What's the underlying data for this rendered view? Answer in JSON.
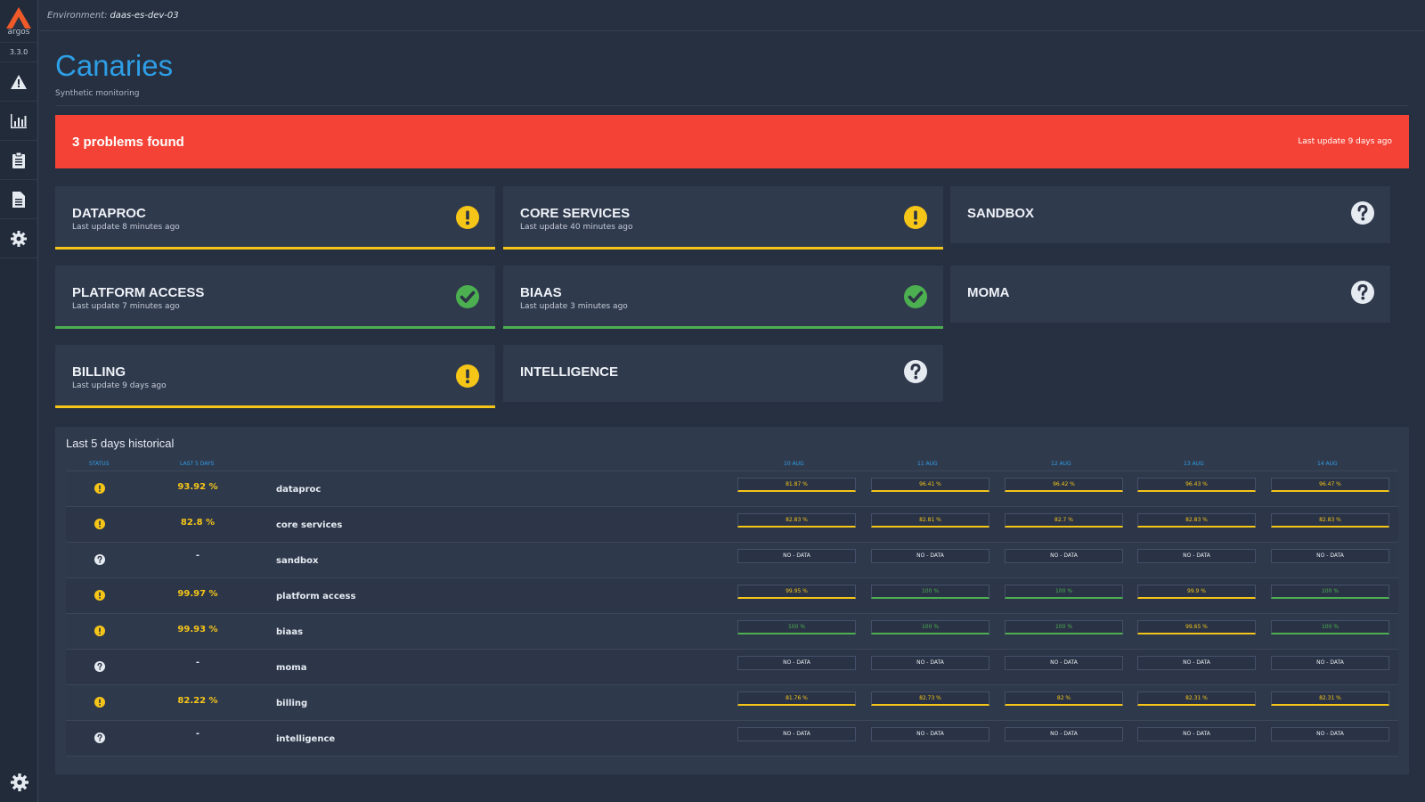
{
  "app": {
    "logo_text": "argos",
    "version": "3.3.0"
  },
  "environment": {
    "label": "Environment:",
    "value": "daas-es-dev-03"
  },
  "page": {
    "title": "Canaries",
    "subtitle": "Synthetic monitoring"
  },
  "alert": {
    "title": "3 problems found",
    "last_update": "Last update 9 days ago",
    "color": "#f44336"
  },
  "colors": {
    "warning": "#f5c518",
    "ok": "#4caf50",
    "accent": "#2e9ee6"
  },
  "cards": [
    {
      "name": "DATAPROC",
      "last_update": "Last update 8 minutes ago",
      "status": "warning",
      "icon": "exclamation-icon"
    },
    {
      "name": "CORE SERVICES",
      "last_update": "Last update 40 minutes ago",
      "status": "warning",
      "icon": "exclamation-icon"
    },
    {
      "name": "SANDBOX",
      "last_update": "",
      "status": "unknown",
      "icon": "question-icon"
    },
    {
      "name": "PLATFORM ACCESS",
      "last_update": "Last update 7 minutes ago",
      "status": "ok",
      "icon": "check-icon"
    },
    {
      "name": "BIAAS",
      "last_update": "Last update 3 minutes ago",
      "status": "ok",
      "icon": "check-icon"
    },
    {
      "name": "MOMA",
      "last_update": "",
      "status": "unknown",
      "icon": "question-icon"
    },
    {
      "name": "BILLING",
      "last_update": "Last update 9 days ago",
      "status": "warning",
      "icon": "exclamation-icon"
    },
    {
      "name": "INTELLIGENCE",
      "last_update": "",
      "status": "unknown",
      "icon": "question-icon"
    }
  ],
  "history": {
    "title": "Last 5 days historical",
    "columns": {
      "status": "STATUS",
      "last5": "LAST 5 DAYS"
    },
    "days": [
      "10 AUG",
      "11 AUG",
      "12 AUG",
      "13 AUG",
      "14 AUG"
    ],
    "rows": [
      {
        "name": "dataproc",
        "status": "warning",
        "pct": "93.92 %",
        "days": [
          {
            "v": "81.87 %",
            "s": "warn"
          },
          {
            "v": "96.41 %",
            "s": "warn"
          },
          {
            "v": "96.42 %",
            "s": "warn"
          },
          {
            "v": "96.43 %",
            "s": "warn"
          },
          {
            "v": "96.47 %",
            "s": "warn"
          }
        ]
      },
      {
        "name": "core services",
        "status": "warning",
        "pct": "82.8 %",
        "days": [
          {
            "v": "82.83 %",
            "s": "warn"
          },
          {
            "v": "82.81 %",
            "s": "warn"
          },
          {
            "v": "82.7 %",
            "s": "warn"
          },
          {
            "v": "82.83 %",
            "s": "warn"
          },
          {
            "v": "82.83 %",
            "s": "warn"
          }
        ]
      },
      {
        "name": "sandbox",
        "status": "unknown",
        "pct": "-",
        "days": [
          {
            "v": "NO - DATA",
            "s": "nodata"
          },
          {
            "v": "NO - DATA",
            "s": "nodata"
          },
          {
            "v": "NO - DATA",
            "s": "nodata"
          },
          {
            "v": "NO - DATA",
            "s": "nodata"
          },
          {
            "v": "NO - DATA",
            "s": "nodata"
          }
        ]
      },
      {
        "name": "platform access",
        "status": "warning",
        "pct": "99.97 %",
        "days": [
          {
            "v": "99.95 %",
            "s": "warn"
          },
          {
            "v": "100 %",
            "s": "ok"
          },
          {
            "v": "100 %",
            "s": "ok"
          },
          {
            "v": "99.9 %",
            "s": "warn"
          },
          {
            "v": "100 %",
            "s": "ok"
          }
        ]
      },
      {
        "name": "biaas",
        "status": "warning",
        "pct": "99.93 %",
        "days": [
          {
            "v": "100 %",
            "s": "ok"
          },
          {
            "v": "100 %",
            "s": "ok"
          },
          {
            "v": "100 %",
            "s": "ok"
          },
          {
            "v": "99.65 %",
            "s": "warn"
          },
          {
            "v": "100 %",
            "s": "ok"
          }
        ]
      },
      {
        "name": "moma",
        "status": "unknown",
        "pct": "-",
        "days": [
          {
            "v": "NO - DATA",
            "s": "nodata"
          },
          {
            "v": "NO - DATA",
            "s": "nodata"
          },
          {
            "v": "NO - DATA",
            "s": "nodata"
          },
          {
            "v": "NO - DATA",
            "s": "nodata"
          },
          {
            "v": "NO - DATA",
            "s": "nodata"
          }
        ]
      },
      {
        "name": "billing",
        "status": "warning",
        "pct": "82.22 %",
        "days": [
          {
            "v": "81.76 %",
            "s": "warn"
          },
          {
            "v": "82.73 %",
            "s": "warn"
          },
          {
            "v": "82 %",
            "s": "warn"
          },
          {
            "v": "82.31 %",
            "s": "warn"
          },
          {
            "v": "82.31 %",
            "s": "warn"
          }
        ]
      },
      {
        "name": "intelligence",
        "status": "unknown",
        "pct": "-",
        "days": [
          {
            "v": "NO - DATA",
            "s": "nodata"
          },
          {
            "v": "NO - DATA",
            "s": "nodata"
          },
          {
            "v": "NO - DATA",
            "s": "nodata"
          },
          {
            "v": "NO - DATA",
            "s": "nodata"
          },
          {
            "v": "NO - DATA",
            "s": "nodata"
          }
        ]
      }
    ]
  }
}
